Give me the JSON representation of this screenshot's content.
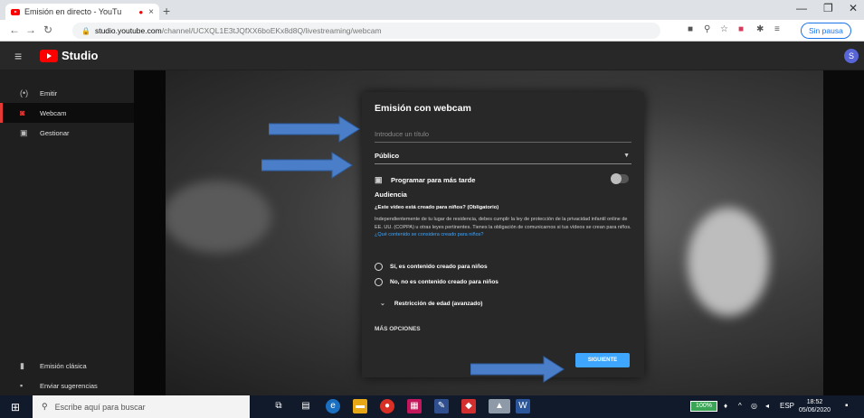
{
  "browser": {
    "tab_title": "Emisión en directo - YouTu",
    "tab_close": "×",
    "new_tab": "+",
    "url_domain": "studio.youtube.com",
    "url_path": "/channel/UCXQL1E3tJQfXX6boEKx8d8Q/livestreaming/webcam",
    "profile_label": "Sin pausa"
  },
  "studio": {
    "logo_text": "Studio",
    "avatar_letter": "S"
  },
  "sidebar": {
    "items": [
      {
        "label": "Emitir"
      },
      {
        "label": "Webcam"
      },
      {
        "label": "Gestionar"
      }
    ],
    "bottom_items": [
      {
        "label": "Emisión clásica"
      },
      {
        "label": "Enviar sugerencias"
      }
    ]
  },
  "dialog": {
    "title": "Emisión con webcam",
    "title_placeholder": "Introduce un título",
    "visibility_value": "Público",
    "schedule_label": "Programar para más tarde",
    "schedule_on": false,
    "audience_heading": "Audiencia",
    "audience_question": "¿Este vídeo está creado para niños? (Obligatorio)",
    "audience_text": "Independientemente de tu lugar de residencia, debes cumplir la ley de protección de la privacidad infantil online de EE. UU. (COPPA) u otras leyes pertinentes. Tienes la obligación de comunicarnos si tus vídeos se crean para niños.",
    "audience_link": "¿Qué contenido se considera creado para niños?",
    "option_yes": "Sí, es contenido creado para niños",
    "option_no": "No, no es contenido creado para niños",
    "age_restriction": "Restricción de edad (avanzado)",
    "more_options": "MÁS OPCIONES",
    "next_button": "SIGUIENTE"
  },
  "taskbar": {
    "search_placeholder": "Escribe aquí para buscar",
    "battery": "100%",
    "lang": "ESP",
    "time": "18:52",
    "date": "05/06/2020"
  },
  "colors": {
    "accent_blue": "#3ea6ff",
    "youtube_red": "#ff0000",
    "annotation_arrow": "#4a7ec8"
  }
}
